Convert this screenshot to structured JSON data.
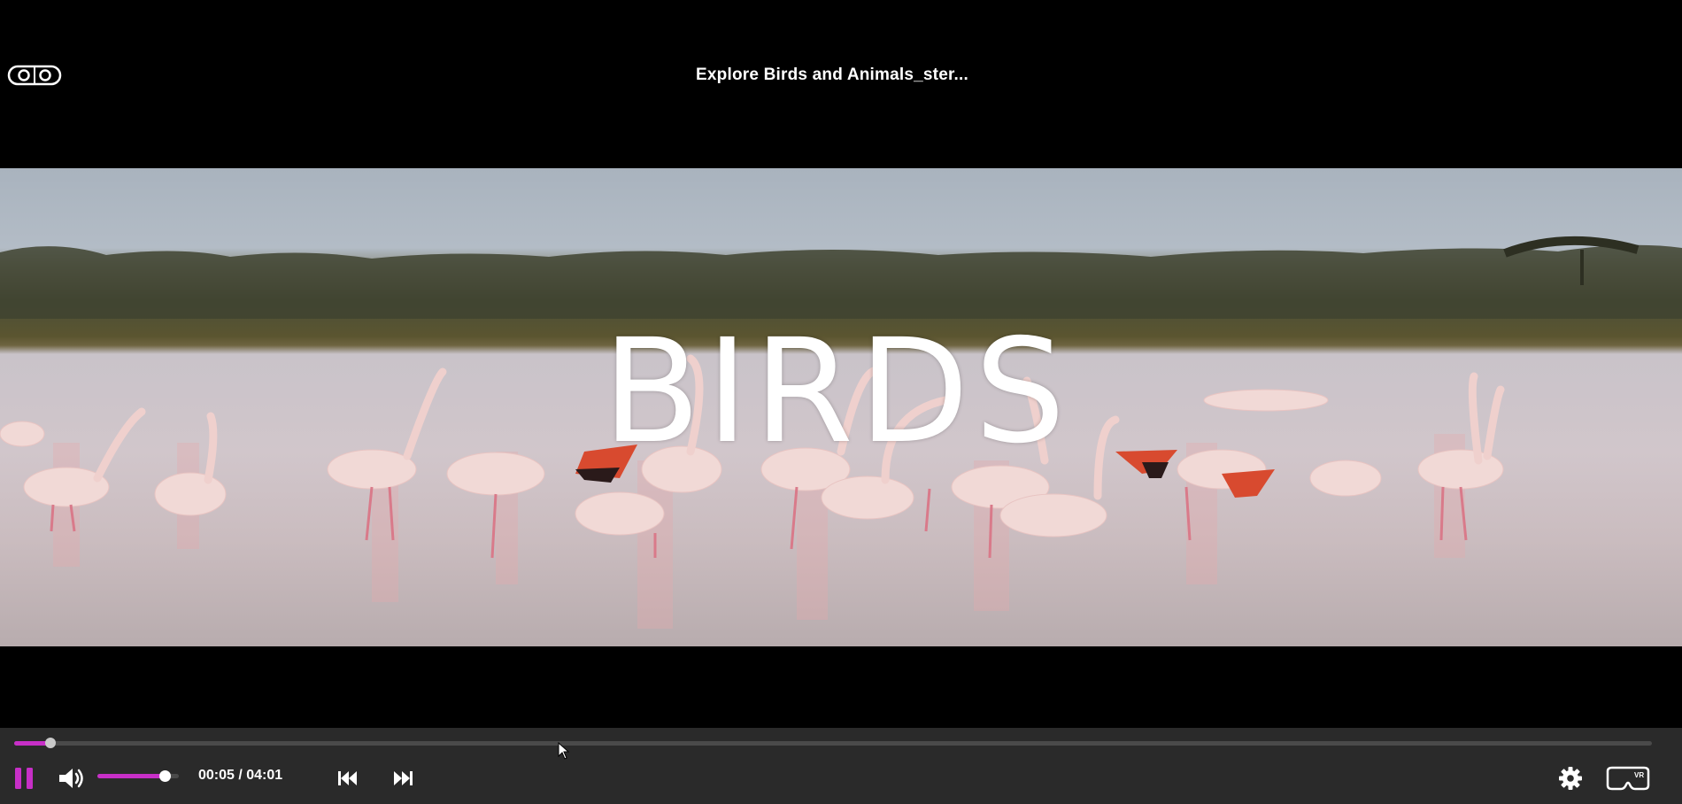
{
  "player": {
    "title": "Explore Birds and Animals_ster...",
    "overlay_text": "BIRDS",
    "icons": {
      "mode_toggle": "stereo-mode-icon",
      "pause": "pause-icon",
      "volume": "volume-icon",
      "previous": "skip-previous-icon",
      "next": "skip-next-icon",
      "settings": "gear-icon",
      "vr": "vr-headset-icon"
    }
  },
  "controls": {
    "time": "00:05 / 04:01",
    "seek_progress": 0.022,
    "volume_level": 0.83,
    "vr_label": "VR"
  },
  "colors": {
    "accent": "#c72fc7",
    "control_bar": "#2a2a2a"
  }
}
